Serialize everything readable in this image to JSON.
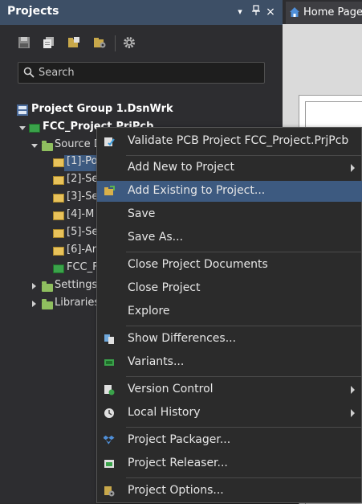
{
  "panel": {
    "title": "Projects",
    "header_buttons": [
      "▾",
      "⊓",
      "×"
    ]
  },
  "search": {
    "placeholder": "Search"
  },
  "tree": {
    "group": "Project Group 1.DsnWrk",
    "project": "FCC_Project.PrjPcb",
    "source_docs": "Source Documents",
    "docs": [
      "[1]-Po",
      "[2]-Se",
      "[3]-Se",
      "[4]-M",
      "[5]-Se",
      "[6]-Ar"
    ],
    "pcb": "FCC_F",
    "settings": "Settings",
    "libraries": "Libraries"
  },
  "right": {
    "home_tab": "Home Page"
  },
  "menu": {
    "items": [
      {
        "label": "Validate PCB Project FCC_Project.PrjPcb",
        "icon": "validate-icon"
      },
      {
        "label": "Add New to Project",
        "submenu": true
      },
      {
        "label": "Add Existing to Project...",
        "icon": "folder-open-icon",
        "highlighted": true
      },
      {
        "label": "Save"
      },
      {
        "label": "Save As..."
      },
      {
        "label": "Close Project Documents"
      },
      {
        "label": "Close Project"
      },
      {
        "label": "Explore"
      },
      {
        "label": "Show Differences...",
        "icon": "differences-icon"
      },
      {
        "label": "Variants...",
        "icon": "variants-icon"
      },
      {
        "label": "Version Control",
        "icon": "version-control-icon",
        "submenu": true
      },
      {
        "label": "Local History",
        "icon": "history-icon",
        "submenu": true
      },
      {
        "label": "Project Packager...",
        "icon": "packager-icon"
      },
      {
        "label": "Project Releaser...",
        "icon": "releaser-icon"
      },
      {
        "label": "Project Options...",
        "icon": "options-icon"
      }
    ]
  },
  "colors": {
    "panel_header": "#3d4f66",
    "highlight": "#3d5a80",
    "menu_bg": "#2b2b2b"
  }
}
